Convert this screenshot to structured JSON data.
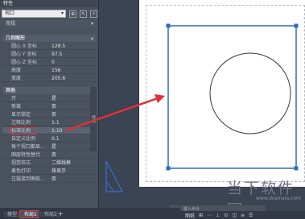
{
  "palette": {
    "title": "特性",
    "selector_value": "视口",
    "sections": {
      "general": "常规",
      "geometry": "几何图形",
      "misc": "其他"
    },
    "geometry_rows": [
      {
        "label": "圆心 X 坐标",
        "value": "128.5"
      },
      {
        "label": "圆心 Y 坐标",
        "value": "97.5"
      },
      {
        "label": "圆心 Z 坐标",
        "value": "0"
      },
      {
        "label": "高度",
        "value": "156"
      },
      {
        "label": "宽度",
        "value": "205.6"
      }
    ],
    "misc_rows": [
      {
        "label": "开",
        "value": "是"
      },
      {
        "label": "剪裁",
        "value": "否"
      },
      {
        "label": "显示锁定",
        "value": "否"
      },
      {
        "label": "注释比例",
        "value": "1:1"
      },
      {
        "label": "标准比例",
        "value": "1:10"
      },
      {
        "label": "自定义比例",
        "value": "0.1"
      },
      {
        "label": "每个视口都显...",
        "value": "是"
      },
      {
        "label": "图层特性替代",
        "value": "否"
      },
      {
        "label": "视觉样式",
        "value": "二维线框"
      },
      {
        "label": "着色打印",
        "value": "按显示"
      },
      {
        "label": "已链接到图纸...",
        "value": "否"
      }
    ],
    "side_tab": "特性"
  },
  "tabs": {
    "model": "模型",
    "layout1": "布局1",
    "layout2": "布局2",
    "add": "+"
  },
  "command_line": {
    "placeholder": "键入命令"
  },
  "statusbar": {
    "paper": "图纸"
  },
  "watermark": {
    "name": "当下软件园",
    "url": "www.downxia.com"
  },
  "colors": {
    "accent_red": "#e0303a",
    "viewport_blue": "#2b6cc4"
  }
}
